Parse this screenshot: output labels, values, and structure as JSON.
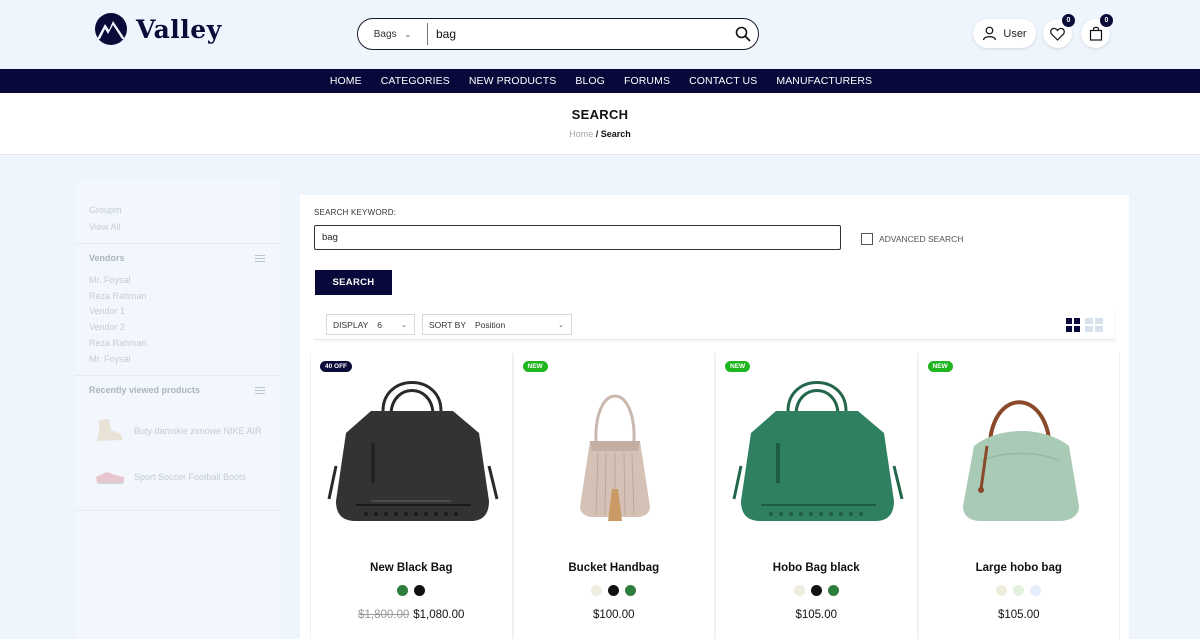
{
  "header": {
    "logo_text": "Valley",
    "search": {
      "category": "Bags",
      "value": "bag"
    },
    "user_label": "User",
    "wishlist_count": "0",
    "cart_count": "0"
  },
  "nav": [
    "HOME",
    "CATEGORIES",
    "NEW PRODUCTS",
    "BLOG",
    "FORUMS",
    "CONTACT US",
    "MANUFACTURERS"
  ],
  "page": {
    "title": "SEARCH",
    "breadcrumb_home": "Home",
    "breadcrumb_sep": "/",
    "breadcrumb_current": "Search"
  },
  "sidebar": {
    "top_items": [
      "Groupm",
      "View All"
    ],
    "vendors_heading": "Vendors",
    "vendors": [
      "Mr. Foysal",
      "Reza Rahman",
      "Vendor 1",
      "Vendor 2",
      "Reza Rahman",
      "Mr. Foysal"
    ],
    "recent_heading": "Recently viewed products",
    "recent": [
      "Buty damskie zimowe NIKE AIR",
      "Sport Soccer Football Boots"
    ]
  },
  "search_form": {
    "keyword_label": "SEARCH KEYWORD:",
    "keyword_value": "bag",
    "advanced_label": "ADVANCED SEARCH",
    "button": "SEARCH"
  },
  "toolbar": {
    "display_label": "DISPLAY",
    "display_value": "6",
    "sort_label": "SORT BY",
    "sort_value": "Position"
  },
  "products": [
    {
      "badge": "40 OFF",
      "name": "New Black Bag",
      "old_price": "$1,800.00",
      "price": "$1,080.00",
      "swatches": [
        "#2e7d3a",
        "#111111"
      ]
    },
    {
      "badge": "NEW",
      "name": "Bucket Handbag",
      "old_price": "",
      "price": "$100.00",
      "swatches": [
        "#efece0",
        "#111111",
        "#2e7d3a"
      ]
    },
    {
      "badge": "NEW",
      "name": "Hobo Bag black",
      "old_price": "",
      "price": "$105.00",
      "swatches": [
        "#efece0",
        "#111111",
        "#2e7d3a"
      ]
    },
    {
      "badge": "NEW",
      "name": "Large hobo bag",
      "old_price": "",
      "price": "$105.00",
      "swatches": [
        "#efecdc",
        "#e3f2dd",
        "#e3eefa"
      ]
    }
  ],
  "colors": {
    "navy": "#08083a",
    "new_badge": "#1fb51f",
    "page_bg": "#eef5fd"
  }
}
